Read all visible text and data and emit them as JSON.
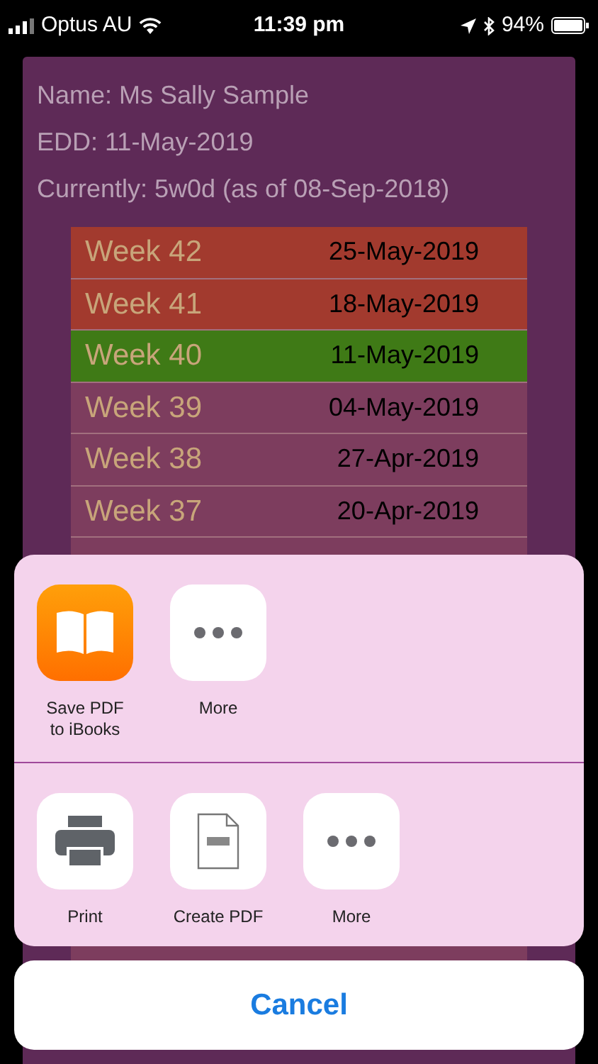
{
  "status_bar": {
    "carrier": "Optus AU",
    "time": "11:39 pm",
    "battery": "94%"
  },
  "patient": [
    "Name: Ms Sally Sample",
    "EDD: 11-May-2019",
    "Currently: 5w0d (as of 08-Sep-2018)"
  ],
  "weeks": [
    {
      "week": "Week 42",
      "date": "25-May-2019",
      "color": "#a23a2e"
    },
    {
      "week": "Week 41",
      "date": "18-May-2019",
      "color": "#a23a2e"
    },
    {
      "week": "Week 40",
      "date": "11-May-2019",
      "color": "#3f7a16"
    },
    {
      "week": "Week 39",
      "date": "04-May-2019",
      "color": "#7d3d5e"
    },
    {
      "week": "Week 38",
      "date": "27-Apr-2019",
      "color": "#7d3d5e"
    },
    {
      "week": "Week 37",
      "date": "20-Apr-2019",
      "color": "#7d3d5e"
    }
  ],
  "share_sheet": {
    "apps": [
      {
        "label": "Save PDF\nto iBooks",
        "kind": "books"
      },
      {
        "label": "More",
        "kind": "more"
      }
    ],
    "actions": [
      {
        "label": "Print",
        "kind": "print"
      },
      {
        "label": "Create PDF",
        "kind": "pdf"
      },
      {
        "label": "More",
        "kind": "more"
      }
    ],
    "cancel": "Cancel"
  }
}
